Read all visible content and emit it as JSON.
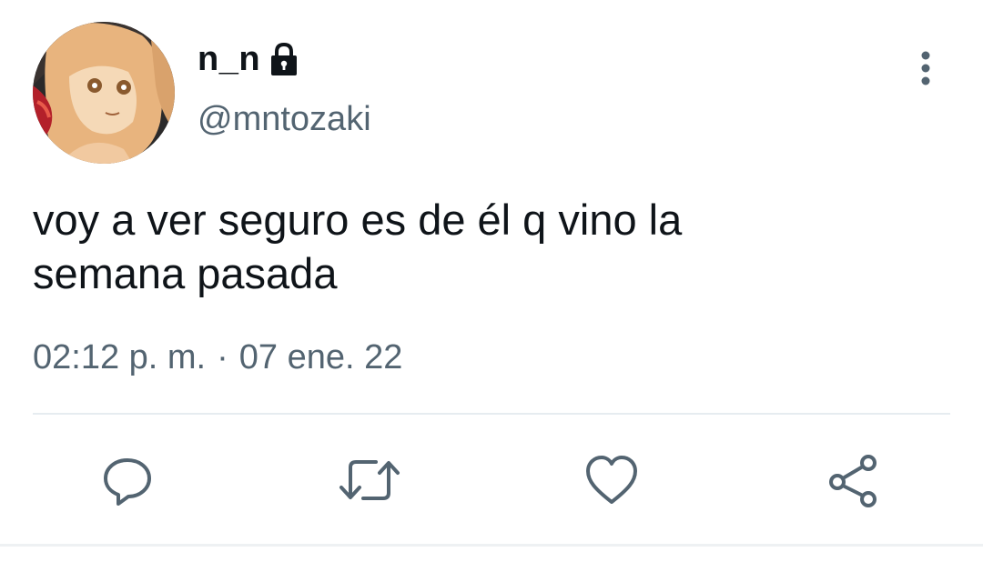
{
  "tweet": {
    "display_name": "n_n",
    "handle": "@mntozaki",
    "text_line1": "voy a ver seguro es de él q vino la",
    "text_line2": "semana pasada",
    "time": "02:12 p. m.",
    "separator": "·",
    "date": "07 ene. 22",
    "protected": true
  },
  "icons": {
    "lock": "lock-icon",
    "more": "more-vertical-icon",
    "reply": "reply-icon",
    "retweet": "retweet-icon",
    "like": "heart-icon",
    "share": "share-icon"
  },
  "colors": {
    "text_primary": "#0f1419",
    "text_secondary": "#536471",
    "icon": "#536471",
    "divider": "#e6ecf0"
  }
}
